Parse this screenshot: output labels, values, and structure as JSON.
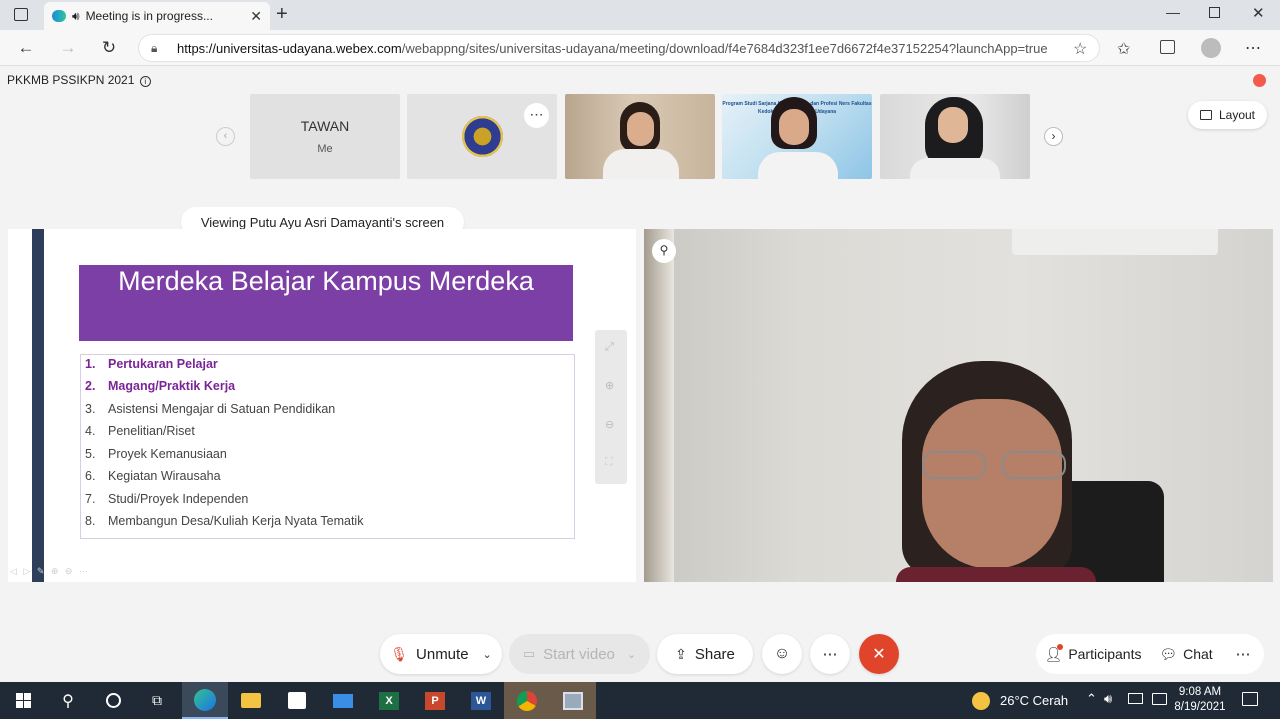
{
  "browser": {
    "tab_title": "Meeting is in progress...",
    "url_host": "https://universitas-udayana.webex.com",
    "url_path": "/webappng/sites/universitas-udayana/meeting/download/f4e7684d323f1ee7d6672f4e37152254?launchApp=true"
  },
  "meeting": {
    "title": "PKKMB PSSIKPN 2021",
    "layout_label": "Layout",
    "viewing_label": "Viewing Putu Ayu Asri Damayanti's screen",
    "thumbnails": [
      {
        "name": "TAWAN",
        "sub": "Me"
      }
    ],
    "thumb_banner": "Program Studi Sarjana Keperawatan dan Profesi Ners Fakultas Kedokteran Universitas Udayana"
  },
  "slide": {
    "title": "Merdeka Belajar Kampus Merdeka",
    "items": [
      {
        "n": "1.",
        "text": "Pertukaran Pelajar"
      },
      {
        "n": "2.",
        "text": "Magang/Praktik Kerja"
      },
      {
        "n": "3.",
        "text": "Asistensi Mengajar di Satuan Pendidikan"
      },
      {
        "n": "4.",
        "text": "Penelitian/Riset"
      },
      {
        "n": "5.",
        "text": "Proyek Kemanusiaan"
      },
      {
        "n": "6.",
        "text": "Kegiatan Wirausaha"
      },
      {
        "n": "7.",
        "text": "Studi/Proyek Independen"
      },
      {
        "n": "8.",
        "text": "Membangun Desa/Kuliah Kerja Nyata Tematik"
      }
    ]
  },
  "controls": {
    "unmute": "Unmute",
    "start_video": "Start video",
    "share": "Share",
    "participants": "Participants",
    "chat": "Chat",
    "more": "⋯"
  },
  "taskbar": {
    "weather": "26°C  Cerah",
    "time": "9:08 AM",
    "date": "8/19/2021"
  },
  "colors": {
    "slide_title_bg": "#7b3fa6",
    "highlight_text": "#7a2595",
    "end_button": "#e0452c",
    "taskbar": "#1f2a36"
  }
}
